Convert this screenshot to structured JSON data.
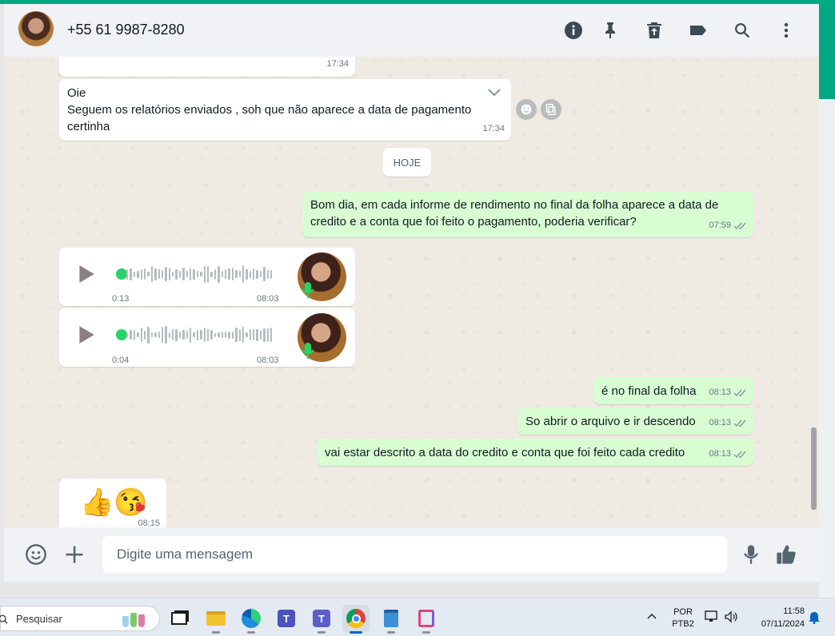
{
  "header": {
    "contact_name": "+55 61 9987-8280",
    "icons": [
      "info-icon",
      "pin-icon",
      "delete-icon",
      "label-icon",
      "search-icon",
      "menu-icon"
    ]
  },
  "messages": {
    "partial_top": {
      "time": "17:34"
    },
    "msg1": {
      "line1": "Oie",
      "line2": "Seguem os relatórios enviados , soh que não aparece a data de pagamento",
      "line3": "certinha",
      "time": "17:34"
    },
    "day_divider": "HOJE",
    "msg2": {
      "line1": "Bom dia, em cada informe de rendimento no final da folha aparece a data de",
      "line2": "credito e a conta que foi feito o pagamento, poderia verificar?",
      "time": "07:59"
    },
    "voice1": {
      "duration": "0:13",
      "time": "08:03"
    },
    "voice2": {
      "duration": "0:04",
      "time": "08:03"
    },
    "msg3": {
      "text": "é no final da folha",
      "time": "08:13"
    },
    "msg4": {
      "text": "So abrir o arquivo e ir descendo",
      "time": "08:13"
    },
    "msg5": {
      "text": "vai estar descrito a data do credito e conta que foi feito cada credito",
      "time": "08:13"
    },
    "msg6": {
      "emoji": "👍😘",
      "time": "08:15"
    }
  },
  "composer": {
    "placeholder": "Digite uma mensagem"
  },
  "taskbar": {
    "search_label": "Pesquisar",
    "lang_top": "POR",
    "lang_bottom": "PTB2",
    "time": "11:58",
    "date": "07/11/2024"
  },
  "colors": {
    "accent": "#00a884",
    "outgoing_bubble": "#d9fdd3",
    "incoming_bubble": "#ffffff",
    "chat_background": "#efeae2"
  }
}
